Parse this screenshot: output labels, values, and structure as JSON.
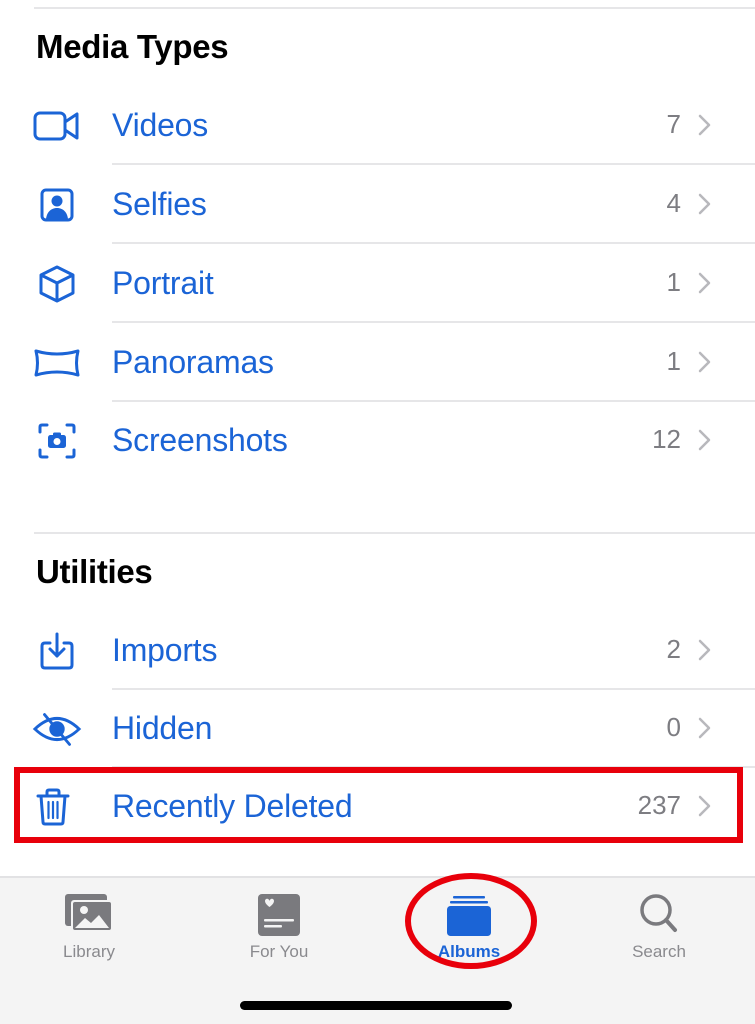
{
  "sections": [
    {
      "title": "Media Types",
      "items": [
        {
          "label": "Videos",
          "count": "7",
          "icon": "video-camera-icon"
        },
        {
          "label": "Selfies",
          "count": "4",
          "icon": "selfie-portrait-icon"
        },
        {
          "label": "Portrait",
          "count": "1",
          "icon": "cube-icon"
        },
        {
          "label": "Panoramas",
          "count": "1",
          "icon": "panorama-icon"
        },
        {
          "label": "Screenshots",
          "count": "12",
          "icon": "screenshot-camera-icon"
        }
      ]
    },
    {
      "title": "Utilities",
      "items": [
        {
          "label": "Imports",
          "count": "2",
          "icon": "import-tray-icon"
        },
        {
          "label": "Hidden",
          "count": "0",
          "icon": "eye-slash-icon"
        },
        {
          "label": "Recently Deleted",
          "count": "237",
          "icon": "trash-icon",
          "highlighted": true
        }
      ]
    }
  ],
  "tabbar": {
    "tabs": [
      {
        "label": "Library",
        "icon": "photo-library-icon",
        "active": false
      },
      {
        "label": "For You",
        "icon": "for-you-heart-icon",
        "active": false
      },
      {
        "label": "Albums",
        "icon": "albums-stack-icon",
        "active": true,
        "highlighted": true
      },
      {
        "label": "Search",
        "icon": "magnifier-icon",
        "active": false
      }
    ]
  },
  "colors": {
    "accent": "#1b64d6",
    "annotation_red": "#e8000b",
    "count_gray": "#7d7d82",
    "tab_inactive": "#8a8a8e",
    "tabbar_bg": "#f4f4f4"
  }
}
